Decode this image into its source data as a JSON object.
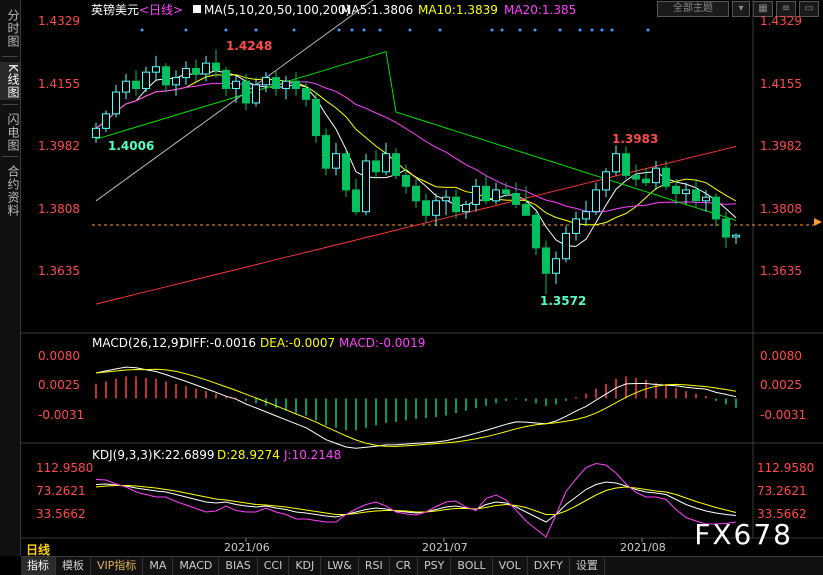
{
  "sidebar": {
    "tabs": [
      {
        "label": "分时图"
      },
      {
        "label": "K线图",
        "active": true
      },
      {
        "label": "闪电图"
      },
      {
        "label": "合约资料"
      }
    ]
  },
  "header": {
    "symbol": "英镑美元",
    "period": "<日线>",
    "ma_label": "MA(5,10,20,50,100,200)",
    "ma5": "MA5:1.3806",
    "ma10": "MA10:1.3839",
    "ma20": "MA20:1.385",
    "theme_label": "全部主题"
  },
  "price_axis": {
    "left_ticks": [
      "1.4329",
      "1.4155",
      "1.3982",
      "1.3808",
      "1.3635"
    ],
    "right_ticks": [
      "1.4329",
      "1.4155",
      "1.3982",
      "1.3808",
      "1.3635"
    ]
  },
  "annotations": {
    "high": "1.4248",
    "start_low": "1.4006",
    "low": "1.3572",
    "swing_high": "1.3983"
  },
  "macd": {
    "title": "MACD(26,12,9)",
    "diff": "DIFF:-0.0016",
    "dea": "DEA:-0.0007",
    "macd": "MACD:-0.0019",
    "ticks": [
      "0.0080",
      "0.0025",
      "-0.0031"
    ]
  },
  "kdj": {
    "title": "KDJ(9,3,3)",
    "k": "K:22.6899",
    "d": "D:28.9274",
    "j": "J:10.2148",
    "ticks": [
      "112.9580",
      "73.2621",
      "33.5662"
    ]
  },
  "time_axis": [
    "2021/06",
    "2021/07",
    "2021/08"
  ],
  "period_label": "日线",
  "bottom_tabs": [
    "指标",
    "模板",
    "VIP指标",
    "MA",
    "MACD",
    "BIAS",
    "CCI",
    "KDJ",
    "LW&",
    "RSI",
    "CR",
    "PSY",
    "BOLL",
    "VOL",
    "DXFY",
    "设置"
  ],
  "watermark": "FX678",
  "colors": {
    "up": "#54ffff",
    "down": "#00c060",
    "ma5": "#ffffff",
    "ma10": "#ffff00",
    "ma20": "#ff40ff",
    "ma50": "#00e000",
    "ma100": "#bbbbbb",
    "ma200": "#ff3333",
    "price_label": "#ff4a4a"
  },
  "chart_data": {
    "type": "candlestick",
    "candles": [
      [
        1.4005,
        1.4045,
        1.399,
        1.403
      ],
      [
        1.403,
        1.408,
        1.402,
        1.407
      ],
      [
        1.407,
        1.415,
        1.406,
        1.413
      ],
      [
        1.413,
        1.418,
        1.411,
        1.416
      ],
      [
        1.416,
        1.419,
        1.412,
        1.414
      ],
      [
        1.414,
        1.42,
        1.413,
        1.4185
      ],
      [
        1.4185,
        1.423,
        1.416,
        1.42
      ],
      [
        1.42,
        1.421,
        1.413,
        1.415
      ],
      [
        1.415,
        1.419,
        1.412,
        1.417
      ],
      [
        1.417,
        1.4215,
        1.415,
        1.4195
      ],
      [
        1.4195,
        1.422,
        1.416,
        1.418
      ],
      [
        1.418,
        1.423,
        1.416,
        1.421
      ],
      [
        1.421,
        1.4248,
        1.417,
        1.419
      ],
      [
        1.419,
        1.42,
        1.412,
        1.414
      ],
      [
        1.414,
        1.4175,
        1.41,
        1.416
      ],
      [
        1.416,
        1.418,
        1.408,
        1.41
      ],
      [
        1.41,
        1.417,
        1.409,
        1.415
      ],
      [
        1.415,
        1.4185,
        1.413,
        1.417
      ],
      [
        1.417,
        1.419,
        1.412,
        1.414
      ],
      [
        1.414,
        1.4175,
        1.411,
        1.416
      ],
      [
        1.416,
        1.4185,
        1.412,
        1.414
      ],
      [
        1.414,
        1.416,
        1.409,
        1.411
      ],
      [
        1.411,
        1.413,
        1.399,
        1.401
      ],
      [
        1.401,
        1.403,
        1.39,
        1.392
      ],
      [
        1.392,
        1.399,
        1.39,
        1.396
      ],
      [
        1.396,
        1.397,
        1.384,
        1.386
      ],
      [
        1.386,
        1.389,
        1.379,
        1.38
      ],
      [
        1.38,
        1.396,
        1.379,
        1.394
      ],
      [
        1.394,
        1.397,
        1.389,
        1.391
      ],
      [
        1.391,
        1.399,
        1.39,
        1.396
      ],
      [
        1.396,
        1.3975,
        1.389,
        1.39
      ],
      [
        1.39,
        1.393,
        1.385,
        1.387
      ],
      [
        1.387,
        1.389,
        1.381,
        1.383
      ],
      [
        1.383,
        1.385,
        1.377,
        1.379
      ],
      [
        1.379,
        1.385,
        1.376,
        1.383
      ],
      [
        1.383,
        1.386,
        1.379,
        1.384
      ],
      [
        1.384,
        1.386,
        1.378,
        1.38
      ],
      [
        1.38,
        1.383,
        1.378,
        1.382
      ],
      [
        1.382,
        1.389,
        1.38,
        1.387
      ],
      [
        1.387,
        1.39,
        1.382,
        1.383
      ],
      [
        1.383,
        1.388,
        1.382,
        1.386
      ],
      [
        1.386,
        1.388,
        1.384,
        1.385
      ],
      [
        1.385,
        1.388,
        1.381,
        1.382
      ],
      [
        1.382,
        1.387,
        1.379,
        1.379
      ],
      [
        1.379,
        1.38,
        1.368,
        1.37
      ],
      [
        1.37,
        1.372,
        1.3572,
        1.363
      ],
      [
        1.363,
        1.369,
        1.36,
        1.367
      ],
      [
        1.367,
        1.376,
        1.366,
        1.374
      ],
      [
        1.374,
        1.38,
        1.372,
        1.378
      ],
      [
        1.378,
        1.383,
        1.376,
        1.38
      ],
      [
        1.38,
        1.388,
        1.379,
        1.386
      ],
      [
        1.386,
        1.392,
        1.384,
        1.391
      ],
      [
        1.391,
        1.3983,
        1.39,
        1.396
      ],
      [
        1.396,
        1.398,
        1.389,
        1.39
      ],
      [
        1.39,
        1.393,
        1.387,
        1.389
      ],
      [
        1.389,
        1.392,
        1.387,
        1.388
      ],
      [
        1.388,
        1.394,
        1.386,
        1.392
      ],
      [
        1.392,
        1.394,
        1.386,
        1.387
      ],
      [
        1.387,
        1.389,
        1.382,
        1.385
      ],
      [
        1.385,
        1.388,
        1.382,
        1.386
      ],
      [
        1.386,
        1.389,
        1.381,
        1.383
      ],
      [
        1.383,
        1.386,
        1.38,
        1.384
      ],
      [
        1.384,
        1.385,
        1.376,
        1.378
      ],
      [
        1.378,
        1.38,
        1.37,
        1.373
      ],
      [
        1.373,
        1.374,
        1.371,
        1.3735
      ]
    ],
    "ylim": [
      1.354,
      1.434
    ],
    "macd_hist": [
      0.003,
      0.0035,
      0.004,
      0.0045,
      0.0045,
      0.0042,
      0.004,
      0.0035,
      0.003,
      0.0025,
      0.002,
      0.0015,
      0.001,
      0.0005,
      0.0002,
      -0.0005,
      -0.001,
      -0.0015,
      -0.002,
      -0.0025,
      -0.003,
      -0.0035,
      -0.0045,
      -0.0055,
      -0.006,
      -0.0065,
      -0.0065,
      -0.006,
      -0.0055,
      -0.005,
      -0.0048,
      -0.0045,
      -0.0042,
      -0.004,
      -0.0038,
      -0.0035,
      -0.003,
      -0.0025,
      -0.002,
      -0.0015,
      -0.001,
      -0.0005,
      -0.0002,
      -0.0005,
      -0.001,
      -0.0015,
      -0.0012,
      -0.0005,
      0.0003,
      0.001,
      0.002,
      0.003,
      0.004,
      0.0045,
      0.0042,
      0.0038,
      0.0032,
      0.0027,
      0.0022,
      0.0015,
      0.001,
      0.0005,
      -0.0005,
      -0.0012,
      -0.0019
    ],
    "macd_ylim": [
      -0.0085,
      0.0095
    ],
    "kdj_k": [
      85,
      86,
      84,
      82,
      78,
      75,
      72,
      70,
      65,
      60,
      55,
      50,
      48,
      50,
      45,
      42,
      40,
      42,
      38,
      35,
      30,
      28,
      25,
      22,
      20,
      25,
      30,
      35,
      38,
      36,
      32,
      30,
      28,
      30,
      35,
      40,
      42,
      38,
      35,
      45,
      50,
      48,
      40,
      30,
      20,
      10,
      25,
      45,
      60,
      75,
      85,
      90,
      88,
      82,
      75,
      70,
      68,
      65,
      55,
      45,
      38,
      32,
      28,
      25,
      23
    ],
    "kdj_d": [
      80,
      82,
      83,
      83,
      82,
      80,
      78,
      75,
      72,
      68,
      64,
      60,
      56,
      54,
      51,
      48,
      45,
      44,
      42,
      40,
      37,
      34,
      31,
      28,
      25,
      25,
      27,
      30,
      32,
      33,
      33,
      32,
      30,
      30,
      32,
      35,
      37,
      37,
      36,
      39,
      43,
      45,
      43,
      39,
      32,
      25,
      25,
      32,
      42,
      53,
      64,
      73,
      78,
      80,
      78,
      75,
      72,
      70,
      65,
      58,
      51,
      45,
      39,
      34,
      29
    ],
    "kdj_j": [
      95,
      94,
      86,
      80,
      70,
      65,
      60,
      60,
      51,
      44,
      37,
      30,
      32,
      42,
      33,
      30,
      30,
      38,
      30,
      25,
      16,
      16,
      13,
      10,
      10,
      25,
      36,
      45,
      50,
      42,
      30,
      26,
      24,
      30,
      41,
      50,
      52,
      40,
      33,
      57,
      64,
      54,
      34,
      12,
      -4,
      -20,
      25,
      71,
      96,
      119,
      127,
      124,
      108,
      86,
      69,
      60,
      60,
      55,
      35,
      19,
      12,
      6,
      6,
      7,
      10
    ]
  }
}
